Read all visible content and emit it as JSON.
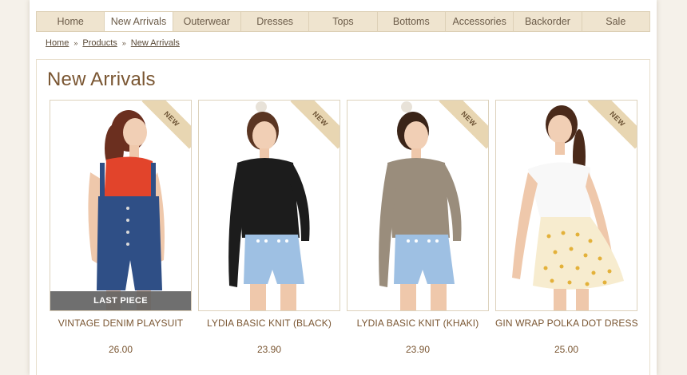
{
  "nav": {
    "items": [
      {
        "label": "Home",
        "active": false
      },
      {
        "label": "New Arrivals",
        "active": true
      },
      {
        "label": "Outerwear",
        "active": false
      },
      {
        "label": "Dresses",
        "active": false
      },
      {
        "label": "Tops",
        "active": false
      },
      {
        "label": "Bottoms",
        "active": false
      },
      {
        "label": "Accessories",
        "active": false
      },
      {
        "label": "Backorder",
        "active": false
      },
      {
        "label": "Sale",
        "active": false
      }
    ]
  },
  "breadcrumb": {
    "items": [
      "Home",
      "Products",
      "New Arrivals"
    ],
    "separator": "»"
  },
  "main": {
    "title": "New Arrivals",
    "ribbon_label": "NEW",
    "products": [
      {
        "name": "VINTAGE DENIM PLAYSUIT",
        "price": "26.00",
        "badge": "LAST PIECE",
        "image": "model-denim-overalls-red-top"
      },
      {
        "name": "LYDIA BASIC KNIT (BLACK)",
        "price": "23.90",
        "badge": "",
        "image": "model-black-knit-blue-shorts"
      },
      {
        "name": "LYDIA BASIC KNIT (KHAKI)",
        "price": "23.90",
        "badge": "",
        "image": "model-khaki-knit-blue-shorts"
      },
      {
        "name": "GIN WRAP POLKA DOT DRESS",
        "price": "25.00",
        "badge": "",
        "image": "model-white-polka-dot-dress"
      }
    ]
  },
  "colors": {
    "nav_bg": "#efe4cf",
    "accent_text": "#7a5632",
    "ribbon": "#e8d6b2",
    "badge_bg": "#5f5f5f"
  }
}
